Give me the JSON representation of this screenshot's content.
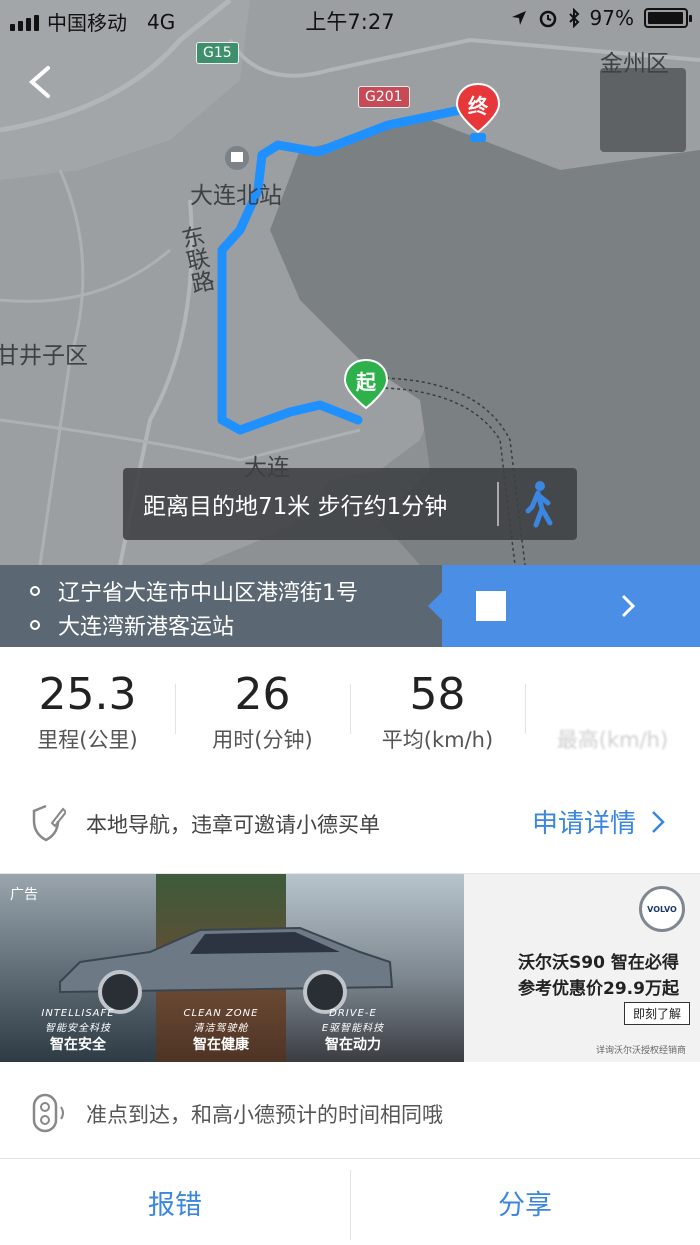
{
  "status_bar": {
    "carrier": "中国移动",
    "network": "4G",
    "time": "上午7:27",
    "battery": "97%",
    "battery_level": 0.97
  },
  "map": {
    "labels": {
      "jinzhou": "金州区",
      "dalian_north": "大连北站",
      "donglian_road": "东联路",
      "ganjingzi": "甘井子区",
      "dalian": "大连"
    },
    "road_tags": {
      "g15": "G15",
      "g201": "G201"
    },
    "start_marker": "起",
    "end_marker": "终",
    "distance_tip": "距离目的地71米 步行约1分钟",
    "colors": {
      "route": "#1e90ff",
      "start": "#2eb14b",
      "end": "#e8373b"
    }
  },
  "route": {
    "from": "辽宁省大连市中山区港湾街1号",
    "to": "大连湾新港客运站"
  },
  "stats": [
    {
      "value": "25.3",
      "label": "里程(公里)"
    },
    {
      "value": "26",
      "label": "用时(分钟)"
    },
    {
      "value": "58",
      "label": "平均(km/h)"
    },
    {
      "value": "",
      "label": "最高(km/h)"
    }
  ],
  "nav_info": {
    "text": "本地导航，违章可邀请小德买单",
    "link": "申请详情"
  },
  "ad": {
    "tag": "广告",
    "captions": [
      {
        "en": "INTELLISAFE",
        "sub": "智能安全科技",
        "cn": "智在安全"
      },
      {
        "en": "CLEAN ZONE",
        "sub": "清洁驾驶舱",
        "cn": "智在健康"
      },
      {
        "en": "DRIVE-E",
        "sub": "E驱智能科技",
        "cn": "智在动力"
      }
    ],
    "logo": "VOLVO",
    "headline_1": "沃尔沃S90 智在必得",
    "headline_2": "参考优惠价29.9万起",
    "cta": "即刻了解",
    "fine_print": "详询沃尔沃授权经销商"
  },
  "arrival": {
    "text": "准点到达，和高小德预计的时间相同哦"
  },
  "actions": {
    "report": "报错",
    "share": "分享"
  }
}
